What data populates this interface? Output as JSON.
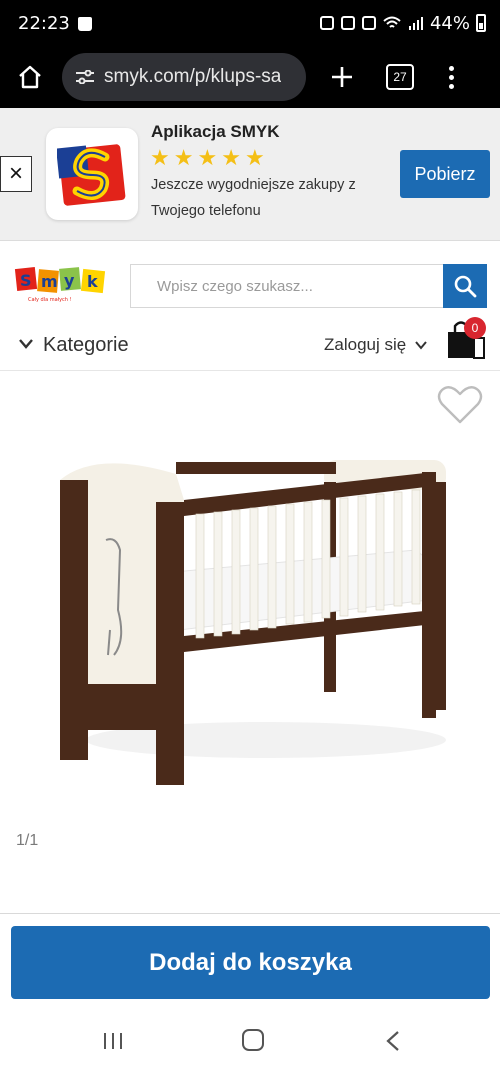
{
  "status_bar": {
    "time": "22:23",
    "battery": "44%"
  },
  "browser": {
    "url": "smyk.com/p/klups-sa",
    "tab_count": "27"
  },
  "app_banner": {
    "close_label": "×",
    "title": "Aplikacja SMYK",
    "stars": [
      "★",
      "★",
      "★",
      "★",
      "★"
    ],
    "desc_line1": "Jeszcze wygodniejsze zakupy z",
    "desc_line2": "Twojego telefonu",
    "get_label": "Pobierz"
  },
  "header": {
    "logo_text": "SMYK",
    "search_placeholder": "Wpisz czego szukasz...",
    "categories_label": "Kategorie",
    "login_label": "Zaloguj się",
    "cart_count": "0"
  },
  "product": {
    "image_counter": "1/1"
  },
  "cta": {
    "add_to_cart_label": "Dodaj do koszyka"
  },
  "colors": {
    "brand_blue": "#1c6bb3",
    "badge_red": "#d8262f",
    "star_yellow": "#f4bf16"
  }
}
